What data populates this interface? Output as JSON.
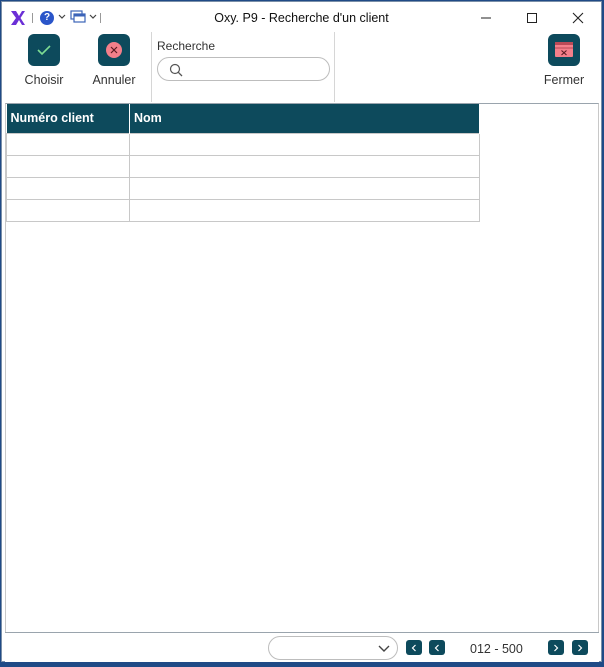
{
  "window": {
    "title": "Oxy. P9 - Recherche d'un client"
  },
  "titlebar_icons": [
    "oxy-logo-icon",
    "help-icon",
    "windows-icon"
  ],
  "help_glyph": "?",
  "toolbar": {
    "choose_label": "Choisir",
    "cancel_label": "Annuler",
    "close_label": "Fermer"
  },
  "search": {
    "label": "Recherche",
    "value": "",
    "placeholder": ""
  },
  "table": {
    "columns": [
      "Numéro client",
      "Nom"
    ],
    "rows": [
      [
        "",
        ""
      ],
      [
        "",
        ""
      ],
      [
        "",
        ""
      ],
      [
        "",
        ""
      ]
    ]
  },
  "pagination": {
    "selected": "",
    "range_text": "012 - 500"
  },
  "colors": {
    "accent": "#0d4a5c",
    "logo": "#6b2fd6",
    "cancel_circle": "#f47f8a",
    "check": "#7ddc93"
  }
}
